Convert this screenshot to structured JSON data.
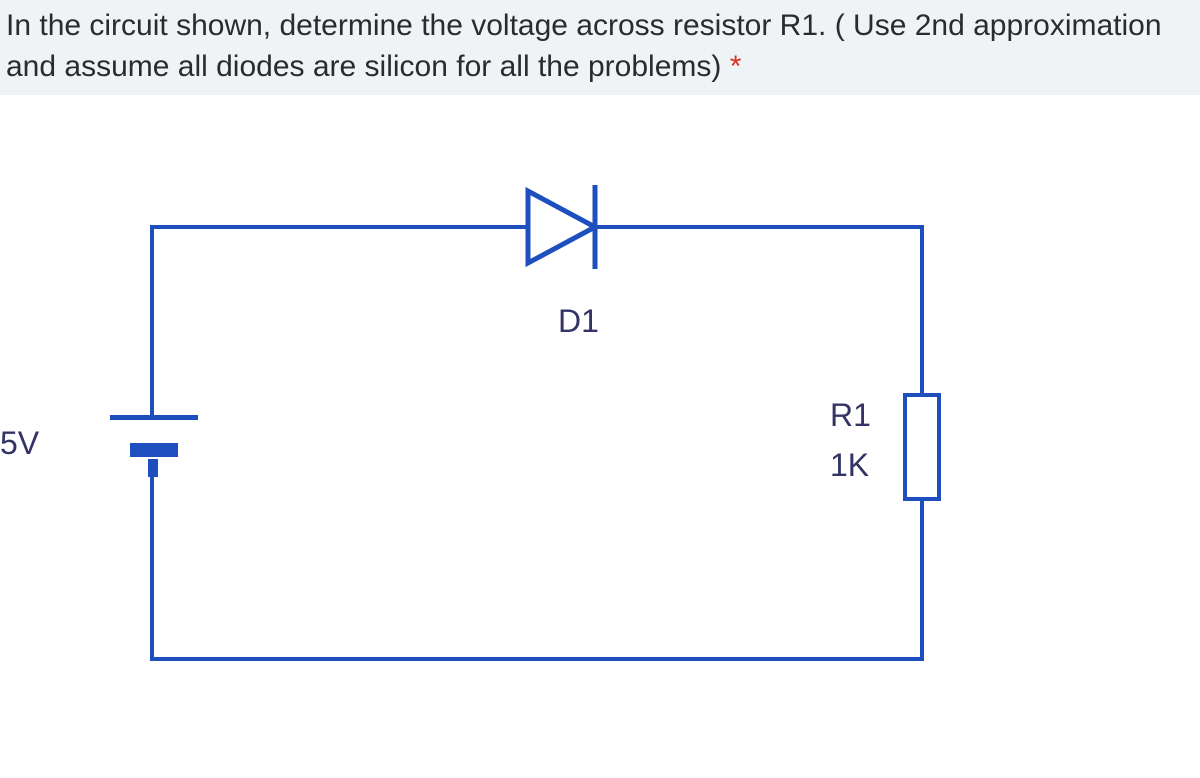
{
  "question": {
    "text": "In the circuit shown, determine the voltage across resistor R1. ( Use 2nd approximation and assume all diodes are silicon for all the problems) ",
    "required_marker": "*"
  },
  "circuit": {
    "source": {
      "label": "5V"
    },
    "diode": {
      "label": "D1"
    },
    "resistor": {
      "name": "R1",
      "value": "1K"
    }
  }
}
